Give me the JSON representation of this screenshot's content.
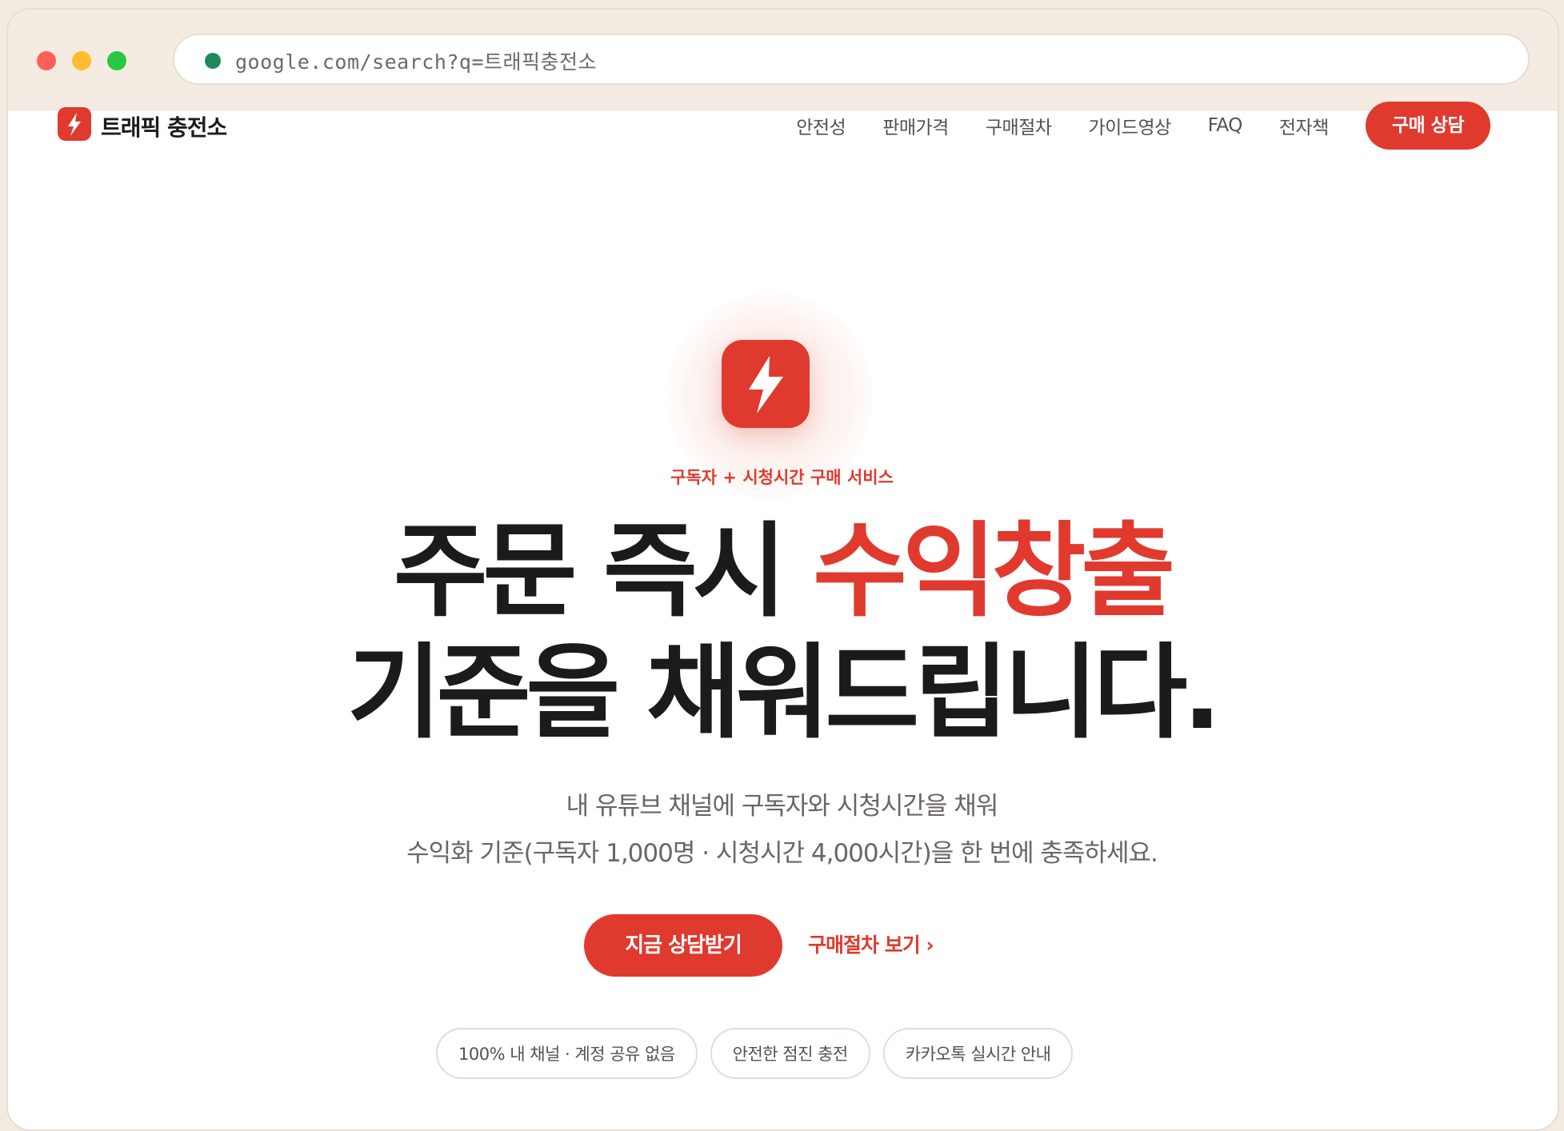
{
  "browser": {
    "url": "google.com/search?q=트래픽충전소"
  },
  "site": {
    "brand": "트래픽 충전소",
    "nav": {
      "items": [
        "안전성",
        "판매가격",
        "구매절차",
        "가이드영상",
        "FAQ",
        "전자책"
      ],
      "cta": "구매 상담"
    }
  },
  "hero": {
    "eyebrow": "구독자 + 시청시간 구매 서비스",
    "headline_line1_a": "주문 즉시 ",
    "headline_line1_accent": "수익창출",
    "headline_line2": "기준을 채워드립니다.",
    "subtext_line1": "내 유튜브 채널에 구독자와 시청시간을 채워",
    "subtext_line2": "수익화 기준(구독자 1,000명 · 시청시간 4,000시간)을 한 번에 충족하세요.",
    "primary_button": "지금 상담받기",
    "secondary_link": "구매절차 보기 ›",
    "chips": [
      "100% 내 채널 · 계정 공유 없음",
      "안전한 점진 충전",
      "카카오톡 실시간 안내"
    ]
  },
  "colors": {
    "accent": "#e03a2f",
    "text": "#1b1b1b",
    "muted": "#6a6662",
    "browser_chrome": "#f4ece3"
  },
  "icons": {
    "brand_logo": "lightning-bolt-icon",
    "secure": "secure-dot-icon"
  }
}
